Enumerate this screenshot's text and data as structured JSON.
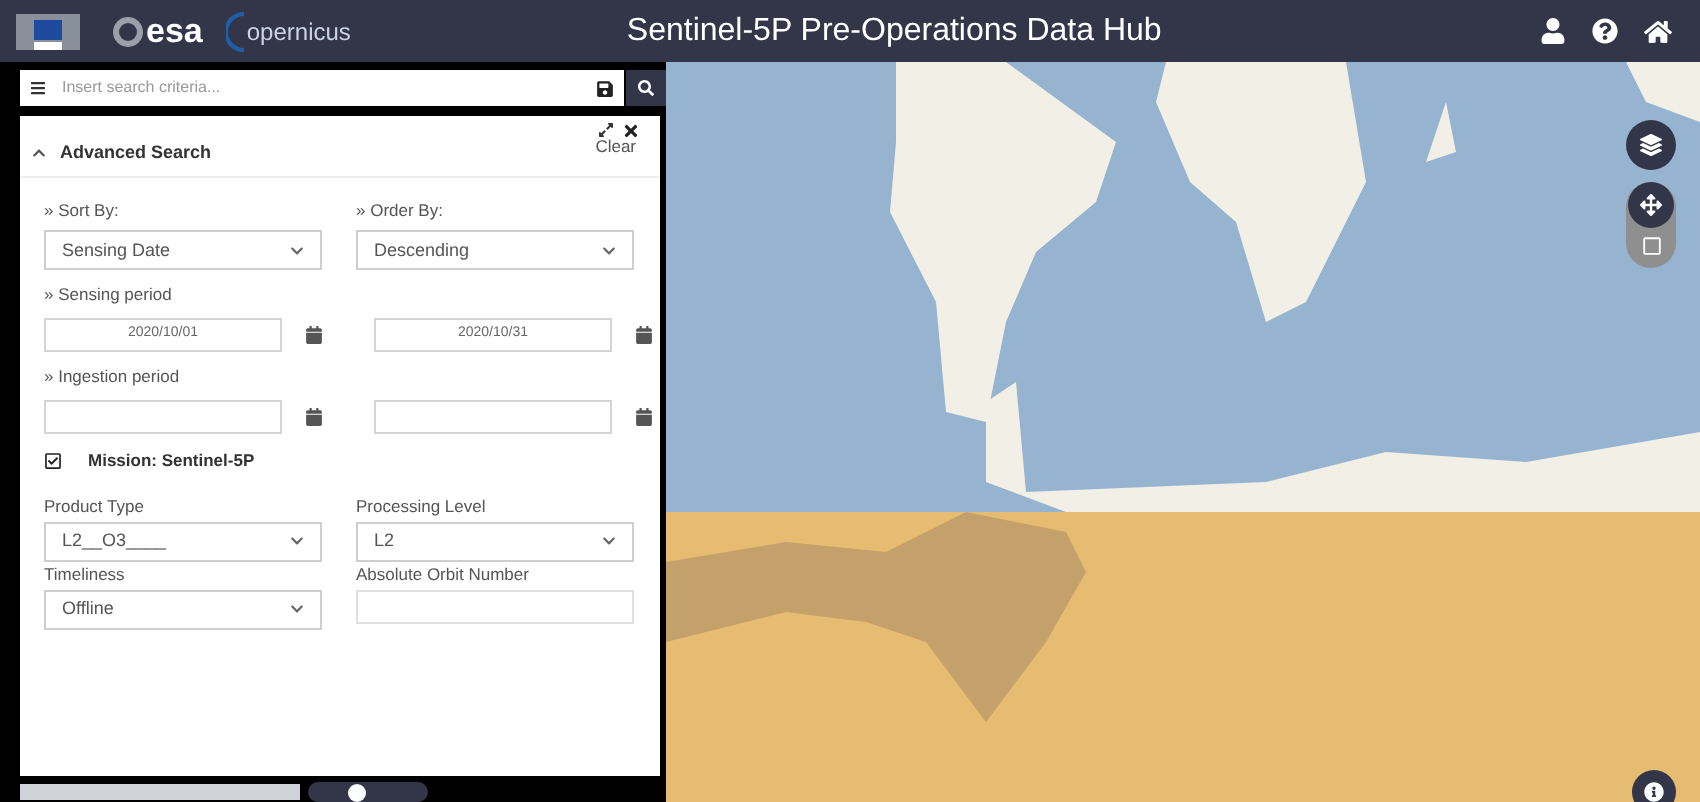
{
  "header": {
    "logos": [
      "esa",
      "opernicus"
    ],
    "title": "Sentinel-5P Pre-Operations Data Hub"
  },
  "search": {
    "placeholder": "Insert search criteria..."
  },
  "toggle": {
    "on": false
  },
  "panel": {
    "title": "Advanced Search",
    "expanded": true,
    "clear": "Clear",
    "sort_by": {
      "label": "» Sort By:",
      "value": "Sensing Date"
    },
    "order_by": {
      "label": "» Order By:",
      "value": "Descending"
    },
    "sensing_period": {
      "label": "» Sensing period",
      "from": "2020/10/01",
      "to": "2020/10/31"
    },
    "ingestion_period": {
      "label": "» Ingestion period"
    },
    "mission": {
      "label": "Mission: Sentinel-5P",
      "checked": true
    },
    "fields": [
      {
        "kind": "select",
        "label": "Product Type",
        "value": "L2__O3____"
      },
      {
        "kind": "select",
        "label": "Processing Level",
        "value": "L2"
      },
      {
        "kind": "select",
        "label": "Timeliness",
        "value": "Offline"
      },
      {
        "kind": "input",
        "label": "Absolute Orbit Number"
      }
    ]
  }
}
